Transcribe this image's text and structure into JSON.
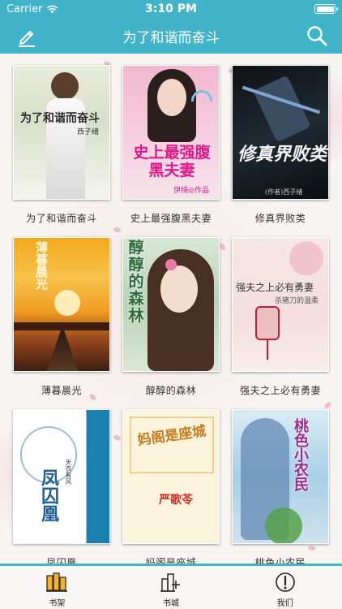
{
  "status_bar": {
    "carrier": "Carrier",
    "time": "3:10 PM"
  },
  "nav": {
    "title": "为了和谐而奋斗",
    "left_icon": "pencil-icon",
    "right_icon": "search-icon"
  },
  "books": [
    {
      "title": "为了和谐而奋斗",
      "cover_text": "为了和谐而奋斗",
      "cover_author": "西子绪"
    },
    {
      "title": "史上最强腹黑夫妻",
      "cover_text": "史上最强腹黑夫妻",
      "cover_author": "伊绮◎作品"
    },
    {
      "title": "修真界败类",
      "cover_text": "修真界败类",
      "cover_author": "(作者)西子绪"
    },
    {
      "title": "薄暮晨光",
      "cover_text": "薄暮晨光"
    },
    {
      "title": "醇醇的森林",
      "cover_text": "醇醇的森林"
    },
    {
      "title": "强夫之上必有勇妻",
      "cover_text": "强夫之上必有勇妻",
      "cover_subtitle": "杀猪刀的温柔"
    },
    {
      "title": "凤囚凰",
      "cover_text": "凤囚凰",
      "cover_author": "天衣有风"
    },
    {
      "title": "妈阁是座城",
      "cover_text": "妈阁是座城",
      "cover_author": "严歌苓"
    },
    {
      "title": "桃色小农民",
      "cover_text": "桃色小农民"
    }
  ],
  "tabs": [
    {
      "label": "书架",
      "icon": "bookshelf-icon",
      "active": true
    },
    {
      "label": "书城",
      "icon": "bookstore-icon",
      "active": false
    },
    {
      "label": "我们",
      "icon": "info-icon",
      "active": false
    }
  ],
  "colors": {
    "primary": "#41b4c9",
    "active_tab": "#f5b41d"
  }
}
